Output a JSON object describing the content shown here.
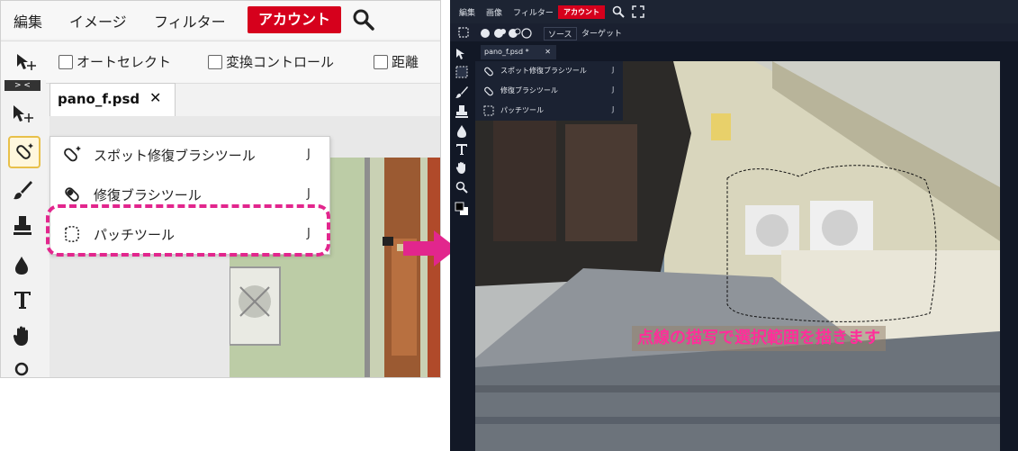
{
  "left_panel": {
    "menu": {
      "edit": "編集",
      "image": "イメージ",
      "filter": "フィルター",
      "account": "アカウント"
    },
    "options": {
      "auto_select": "オートセレクト",
      "transform": "変換コントロール",
      "distance": "距離"
    },
    "collapse_label": "> <",
    "tab": {
      "name": "pano_f.psd",
      "close": "✕"
    },
    "flyout": [
      {
        "label": "スポット修復ブラシツール",
        "shortcut": "J",
        "icon": "spot-healing-icon"
      },
      {
        "label": "修復ブラシツール",
        "shortcut": "J",
        "icon": "healing-brush-icon"
      },
      {
        "label": "パッチツール",
        "shortcut": "J",
        "icon": "patch-icon"
      }
    ],
    "highlight_color": "#e2268d"
  },
  "right_panel": {
    "menu": {
      "edit": "編集",
      "image": "画像",
      "filter": "フィルター",
      "account": "アカウント"
    },
    "options": {
      "source": "ソース",
      "target": "ターゲット"
    },
    "tab": {
      "name": "pano_f.psd *",
      "close": "✕"
    },
    "flyout": [
      {
        "label": "スポット修復ブラシツール",
        "shortcut": "J"
      },
      {
        "label": "修復ブラシツール",
        "shortcut": "J"
      },
      {
        "label": "パッチツール",
        "shortcut": "J"
      }
    ],
    "caption": "点線の描写で選択範囲を描きます"
  },
  "colors": {
    "accent": "#d6001c",
    "arrow": "#e2268d",
    "caption_text": "#ff2e9a"
  }
}
